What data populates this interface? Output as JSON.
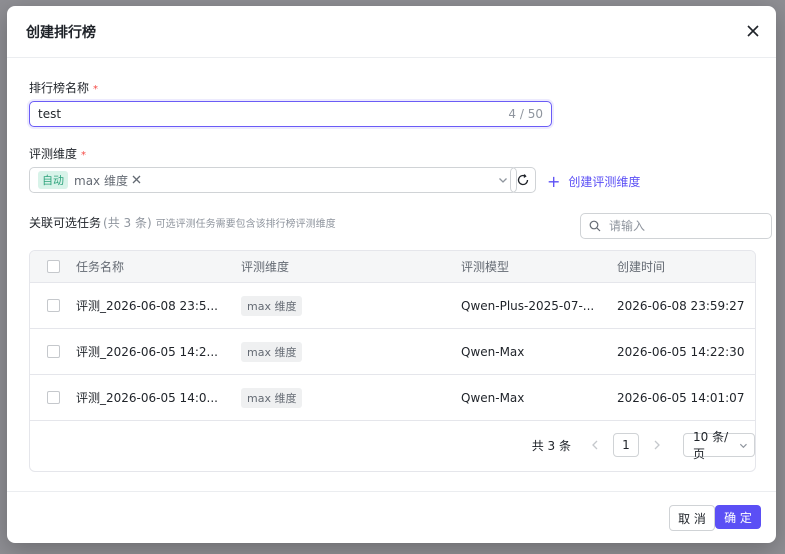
{
  "modal": {
    "title": "创建排行榜"
  },
  "form": {
    "name_label": "排行榜名称",
    "required_mark": "*",
    "name_value": "test",
    "name_count": "4 / 50",
    "dim_label": "评测维度",
    "dim_tag_auto": "自动",
    "dim_tag_value": "max 维度",
    "create_dim": "创建评测维度"
  },
  "tasks": {
    "title": "关联可选任务",
    "count": "(共 3 条)",
    "hint": "可选评测任务需要包含该排行榜评测维度",
    "search_placeholder": "请输入",
    "columns": [
      "任务名称",
      "评测维度",
      "评测模型",
      "创建时间"
    ],
    "rows": [
      {
        "name": "评测_2026-06-08 23:5...",
        "dim": "max 维度",
        "model": "Qwen-Plus-2025-07-...",
        "time": "2026-06-08 23:59:27"
      },
      {
        "name": "评测_2026-06-05 14:2...",
        "dim": "max 维度",
        "model": "Qwen-Max",
        "time": "2026-06-05 14:22:30"
      },
      {
        "name": "评测_2026-06-05 14:0...",
        "dim": "max 维度",
        "model": "Qwen-Max",
        "time": "2026-06-05 14:01:07"
      }
    ],
    "pagination": {
      "total": "共 3 条",
      "page": "1",
      "page_size": "10 条/页"
    }
  },
  "footer": {
    "cancel": "取 消",
    "ok": "确 定"
  },
  "colors": {
    "primary": "#5b4ff5",
    "required": "#f54a45",
    "auto_tag_bg": "#d8f3e9",
    "auto_tag_text": "#2ea47c"
  }
}
